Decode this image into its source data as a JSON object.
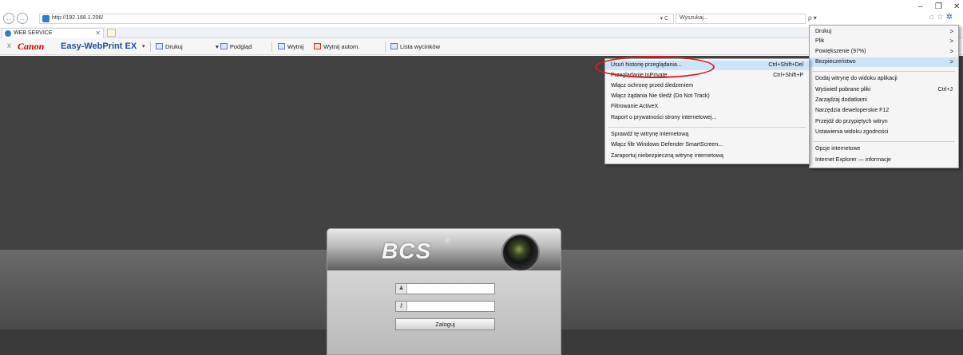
{
  "browser": {
    "url": "http://192.168.1.206/",
    "addr_tools": "▾ C",
    "search_placeholder": "Wyszukaj...",
    "search_tools": "ρ ▾",
    "win_minimize": "–",
    "win_restore": "❐",
    "win_close": "✕",
    "tab_label": "WEB SERVICE",
    "tab_close": "✕"
  },
  "canon_toolbar": {
    "logo": "Canon",
    "product": "Easy-WebPrint EX",
    "caret": "▾",
    "buttons": [
      "Drukuj",
      "Podgląd",
      "Wytnij",
      "Wytnij autom.",
      "Lista wycinków"
    ],
    "podglad_caret": "▾"
  },
  "login": {
    "logo": "BCS",
    "registered": "®",
    "login_button": "Zaloguj"
  },
  "tools_menu": {
    "items": [
      {
        "label": "Drukuj",
        "arrow": ">"
      },
      {
        "label": "Plik",
        "arrow": ">"
      },
      {
        "label": "Powiększenie (97%)",
        "arrow": ">"
      },
      {
        "label": "Bezpieczeństwo",
        "arrow": ">"
      },
      {
        "label": "Dodaj witrynę do widoku aplikacji"
      },
      {
        "label": "Wyświetl pobrane pliki",
        "shortcut": "Ctrl+J"
      },
      {
        "label": "Zarządzaj dodatkami"
      },
      {
        "label": "Narzędzia deweloperskie F12"
      },
      {
        "label": "Przejdź do przypiętych witryn"
      },
      {
        "label": "Ustawienia widoku zgodności"
      },
      {
        "label": "Opcje internetowe"
      },
      {
        "label": "Internet Explorer — informacje"
      }
    ]
  },
  "security_menu": {
    "items": [
      {
        "label": "Usuń historię przeglądania...",
        "shortcut": "Ctrl+Shift+Del"
      },
      {
        "label": "Przeglądanie InPrivate",
        "shortcut": "Ctrl+Shift+P"
      },
      {
        "label": "Włącz ochronę przed śledzeniem"
      },
      {
        "label": "Włącz żądania Nie śledź (Do Not Track)"
      },
      {
        "label": "Filtrowanie ActiveX"
      },
      {
        "label": "Raport o prywatności strony internetowej..."
      },
      {
        "label": "Sprawdź tę witrynę internetową"
      },
      {
        "label": "Włącz filtr Windows Defender SmartScreen..."
      },
      {
        "label": "Zaraportuj niebezpieczną witrynę internetową"
      }
    ]
  },
  "colors": {
    "highlight_ring": "#e01b1b",
    "menu_highlight": "#cce4f7",
    "canon_red": "#cc0000",
    "ewp_blue": "#1f4e9c"
  }
}
